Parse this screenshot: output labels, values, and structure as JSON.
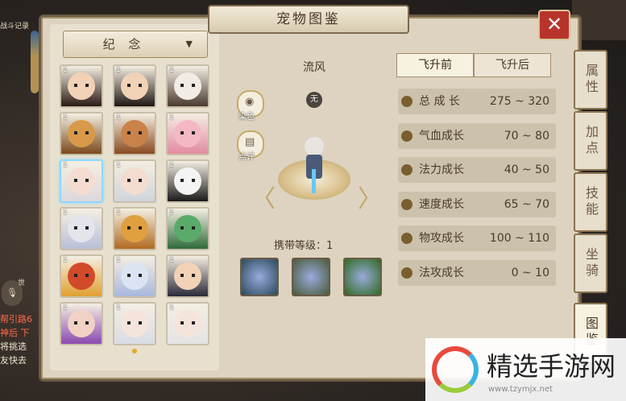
{
  "hud": {
    "record_label": "战斗记录",
    "mic_label": "世",
    "chat_lines": [
      "帮引路6",
      "神后 下",
      "将挑选",
      "友快去"
    ]
  },
  "panel": {
    "title": "宠物图鉴",
    "close_label": "✕",
    "category": "纪 念",
    "category_arrow": "▼"
  },
  "pets": [
    {
      "level": "1",
      "color": "#f2d2b6",
      "hair": "#2a1a14"
    },
    {
      "level": "1",
      "color": "#f2d2b6",
      "hair": "#1e1612"
    },
    {
      "level": "1",
      "color": "#f1ece6",
      "hair": "#4a3a30"
    },
    {
      "level": "1",
      "color": "#d89a4a",
      "hair": "#7a4a1c"
    },
    {
      "level": "1",
      "color": "#c9824a",
      "hair": "#8a4a20"
    },
    {
      "level": "1",
      "color": "#f4b8c4",
      "hair": "#e28aa0"
    },
    {
      "level": "1",
      "color": "#f4dcd0",
      "hair": "#dcd8dc",
      "selected": true
    },
    {
      "level": "1",
      "color": "#f4dcd0",
      "hair": "#d0d4dc"
    },
    {
      "level": "1",
      "color": "#f4f4f4",
      "hair": "#1a1a1a"
    },
    {
      "level": "1",
      "color": "#e4e4ec",
      "hair": "#b8c0d8"
    },
    {
      "level": "1",
      "color": "#e0a040",
      "hair": "#b06a20"
    },
    {
      "level": "1",
      "color": "#5aaa6a",
      "hair": "#2e6a3a"
    },
    {
      "level": "1",
      "color": "#d24a2a",
      "hair": "#e0a030"
    },
    {
      "level": "1",
      "color": "#dce4f4",
      "hair": "#a8b8dc"
    },
    {
      "level": "1",
      "color": "#f2d2b6",
      "hair": "#2a2a3a"
    },
    {
      "level": "1",
      "color": "#f2d2c4",
      "hair": "#8a4ab0"
    },
    {
      "level": "1",
      "color": "#f4e4dc",
      "hair": "#d8dce4"
    },
    {
      "level": "1",
      "color": "#f4e4dc",
      "hair": "#e4e4e4"
    }
  ],
  "detail": {
    "name": "流风",
    "element": "无",
    "dye_label": "染色",
    "comment_label": "点评",
    "carry_label": "携带等级",
    "carry_sep": "：",
    "carry_level": "1",
    "skills": [
      {
        "name": "ring-skill",
        "color": "#2a4a5a"
      },
      {
        "name": "goblin-skill",
        "color": "#4a5a3a"
      },
      {
        "name": "ghost-skill",
        "color": "#2e6a1e"
      }
    ]
  },
  "tabs": [
    "飞升前",
    "飞升后"
  ],
  "stats": [
    {
      "name": "总 成 长",
      "value": "275 ~ 320"
    },
    {
      "name": "气血成长",
      "value": "70 ~ 80"
    },
    {
      "name": "法力成长",
      "value": "40 ~ 50"
    },
    {
      "name": "速度成长",
      "value": "65 ~ 70"
    },
    {
      "name": "物攻成长",
      "value": "100 ~ 110"
    },
    {
      "name": "法攻成长",
      "value": "0 ~ 10"
    }
  ],
  "side_tabs": [
    "属性",
    "加点",
    "技能",
    "坐骑",
    "图鉴"
  ],
  "watermark": {
    "title": "精选手游网",
    "url": "www.tzymjx.net"
  }
}
